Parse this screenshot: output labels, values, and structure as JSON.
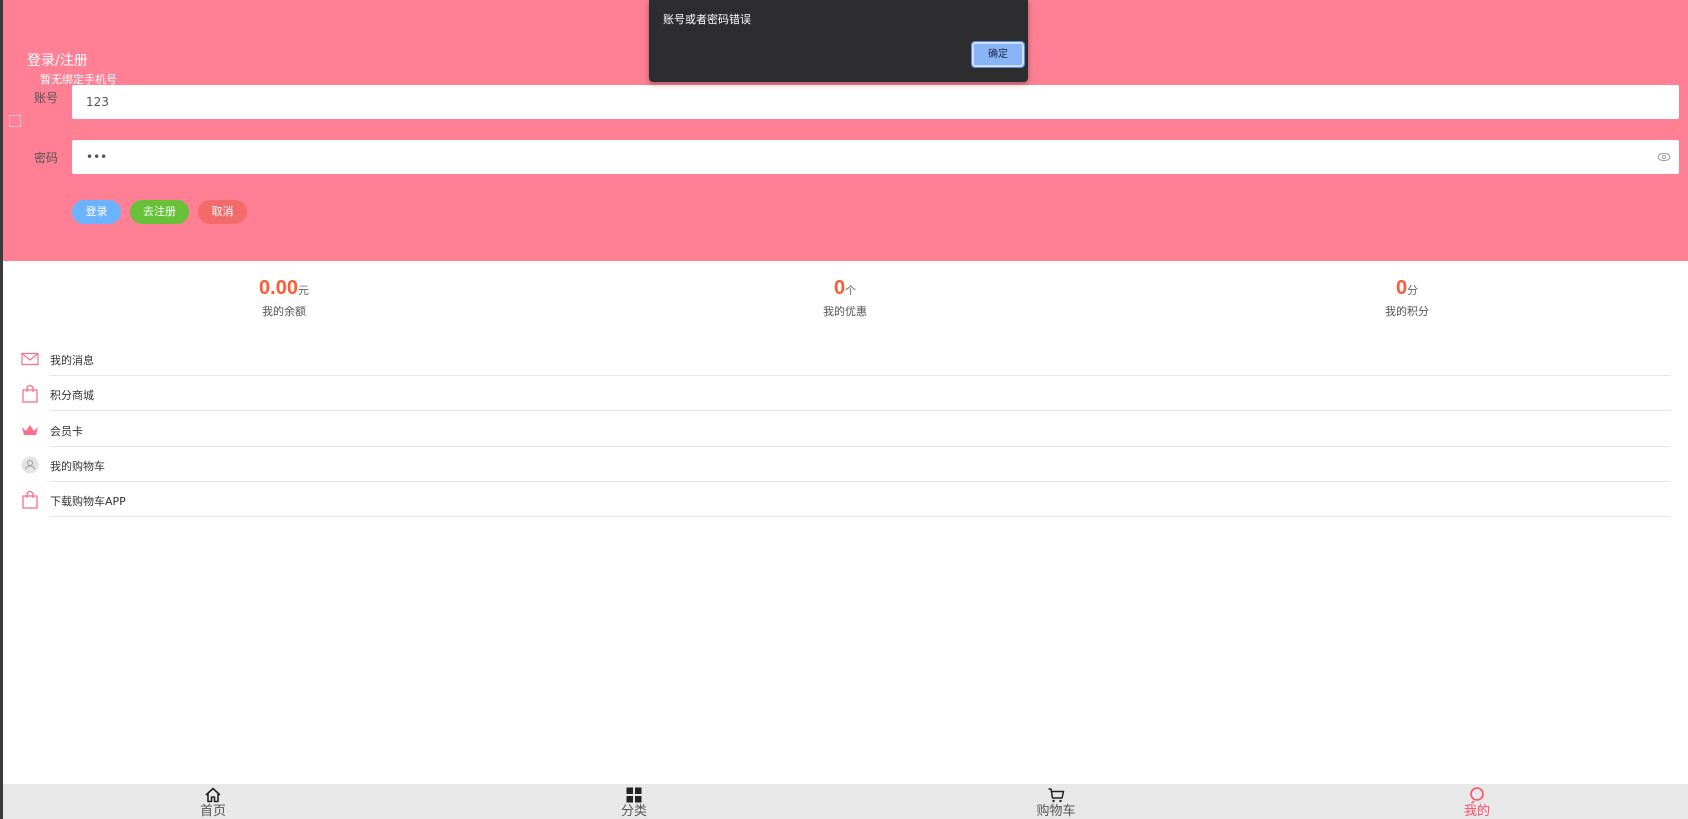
{
  "header": {
    "title": "登录/注册",
    "subtitle": "暂无绑定手机号",
    "background_color": "#ff8094"
  },
  "form": {
    "account_label": "账号",
    "account_value": "123",
    "password_label": "密码",
    "password_value": "•••",
    "buttons": {
      "login": "登录",
      "register": "去注册",
      "cancel": "取消"
    }
  },
  "stats": [
    {
      "value": "0.00",
      "unit": "元",
      "label": "我的余额"
    },
    {
      "value": "0",
      "unit": "个",
      "label": "我的优惠"
    },
    {
      "value": "0",
      "unit": "分",
      "label": "我的积分"
    }
  ],
  "menu": [
    {
      "label": "我的消息",
      "icon": "mail-icon"
    },
    {
      "label": "积分商城",
      "icon": "shopping-bag-icon"
    },
    {
      "label": "会员卡",
      "icon": "crown-icon"
    },
    {
      "label": "我的购物车",
      "icon": "user-circle-icon"
    },
    {
      "label": "下载购物车APP",
      "icon": "shopping-bag-icon"
    }
  ],
  "bottom_nav": [
    {
      "label": "首页",
      "icon": "home-icon"
    },
    {
      "label": "分类",
      "icon": "grid-icon"
    },
    {
      "label": "购物车",
      "icon": "cart-icon"
    },
    {
      "label": "我的",
      "icon": "profile-icon",
      "active": true
    }
  ],
  "dialog": {
    "message": "账号或者密码错误",
    "ok_label": "确定"
  },
  "colors": {
    "accent": "#ff4d6a",
    "stat_value": "#ff5a36",
    "login_button": "#6cb3ff",
    "register_button": "#67c23a",
    "cancel_button": "#f36b6b"
  }
}
